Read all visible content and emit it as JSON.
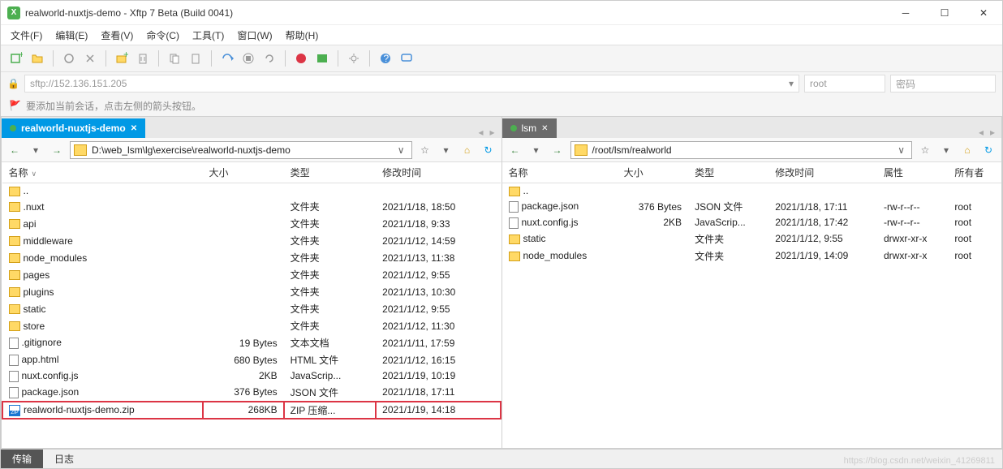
{
  "window": {
    "title": "realworld-nuxtjs-demo - Xftp 7 Beta (Build 0041)",
    "app_icon_text": "X"
  },
  "menu": {
    "file": "文件(F)",
    "edit": "编辑(E)",
    "view": "查看(V)",
    "commands": "命令(C)",
    "tools": "工具(T)",
    "window": "窗口(W)",
    "help": "帮助(H)"
  },
  "address": {
    "url": "sftp://152.136.151.205",
    "user": "root",
    "password_placeholder": "密码"
  },
  "hint": "要添加当前会话，点击左侧的箭头按钮。",
  "local": {
    "tab_label": "realworld-nuxtjs-demo",
    "path": "D:\\web_lsm\\lg\\exercise\\realworld-nuxtjs-demo",
    "columns": {
      "name": "名称",
      "size": "大小",
      "type": "类型",
      "modified": "修改时间"
    },
    "rows": [
      {
        "icon": "folder",
        "name": "..",
        "size": "",
        "type": "",
        "modified": ""
      },
      {
        "icon": "folder",
        "name": ".nuxt",
        "size": "",
        "type": "文件夹",
        "modified": "2021/1/18, 18:50"
      },
      {
        "icon": "folder",
        "name": "api",
        "size": "",
        "type": "文件夹",
        "modified": "2021/1/18, 9:33"
      },
      {
        "icon": "folder",
        "name": "middleware",
        "size": "",
        "type": "文件夹",
        "modified": "2021/1/12, 14:59"
      },
      {
        "icon": "folder",
        "name": "node_modules",
        "size": "",
        "type": "文件夹",
        "modified": "2021/1/13, 11:38"
      },
      {
        "icon": "folder",
        "name": "pages",
        "size": "",
        "type": "文件夹",
        "modified": "2021/1/12, 9:55"
      },
      {
        "icon": "folder",
        "name": "plugins",
        "size": "",
        "type": "文件夹",
        "modified": "2021/1/13, 10:30"
      },
      {
        "icon": "folder",
        "name": "static",
        "size": "",
        "type": "文件夹",
        "modified": "2021/1/12, 9:55"
      },
      {
        "icon": "folder",
        "name": "store",
        "size": "",
        "type": "文件夹",
        "modified": "2021/1/12, 11:30"
      },
      {
        "icon": "file",
        "name": ".gitignore",
        "size": "19 Bytes",
        "type": "文本文档",
        "modified": "2021/1/11, 17:59"
      },
      {
        "icon": "file",
        "name": "app.html",
        "size": "680 Bytes",
        "type": "HTML 文件",
        "modified": "2021/1/12, 16:15"
      },
      {
        "icon": "file",
        "name": "nuxt.config.js",
        "size": "2KB",
        "type": "JavaScrip...",
        "modified": "2021/1/19, 10:19"
      },
      {
        "icon": "file",
        "name": "package.json",
        "size": "376 Bytes",
        "type": "JSON 文件",
        "modified": "2021/1/18, 17:11"
      },
      {
        "icon": "zip",
        "name": "realworld-nuxtjs-demo.zip",
        "size": "268KB",
        "type": "ZIP 压缩...",
        "modified": "2021/1/19, 14:18",
        "highlight": true
      }
    ]
  },
  "remote": {
    "tab_label": "lsm",
    "path": "/root/lsm/realworld",
    "columns": {
      "name": "名称",
      "size": "大小",
      "type": "类型",
      "modified": "修改时间",
      "attrs": "属性",
      "owner": "所有者"
    },
    "rows": [
      {
        "icon": "folder",
        "name": "..",
        "size": "",
        "type": "",
        "modified": "",
        "attrs": "",
        "owner": ""
      },
      {
        "icon": "file",
        "name": "package.json",
        "size": "376 Bytes",
        "type": "JSON 文件",
        "modified": "2021/1/18, 17:11",
        "attrs": "-rw-r--r--",
        "owner": "root"
      },
      {
        "icon": "file",
        "name": "nuxt.config.js",
        "size": "2KB",
        "type": "JavaScrip...",
        "modified": "2021/1/18, 17:42",
        "attrs": "-rw-r--r--",
        "owner": "root"
      },
      {
        "icon": "folder",
        "name": "static",
        "size": "",
        "type": "文件夹",
        "modified": "2021/1/12, 9:55",
        "attrs": "drwxr-xr-x",
        "owner": "root"
      },
      {
        "icon": "folder",
        "name": "node_modules",
        "size": "",
        "type": "文件夹",
        "modified": "2021/1/19, 14:09",
        "attrs": "drwxr-xr-x",
        "owner": "root"
      }
    ]
  },
  "status": {
    "transfer": "传输",
    "log": "日志"
  },
  "watermark": "https://blog.csdn.net/weixin_41269811"
}
